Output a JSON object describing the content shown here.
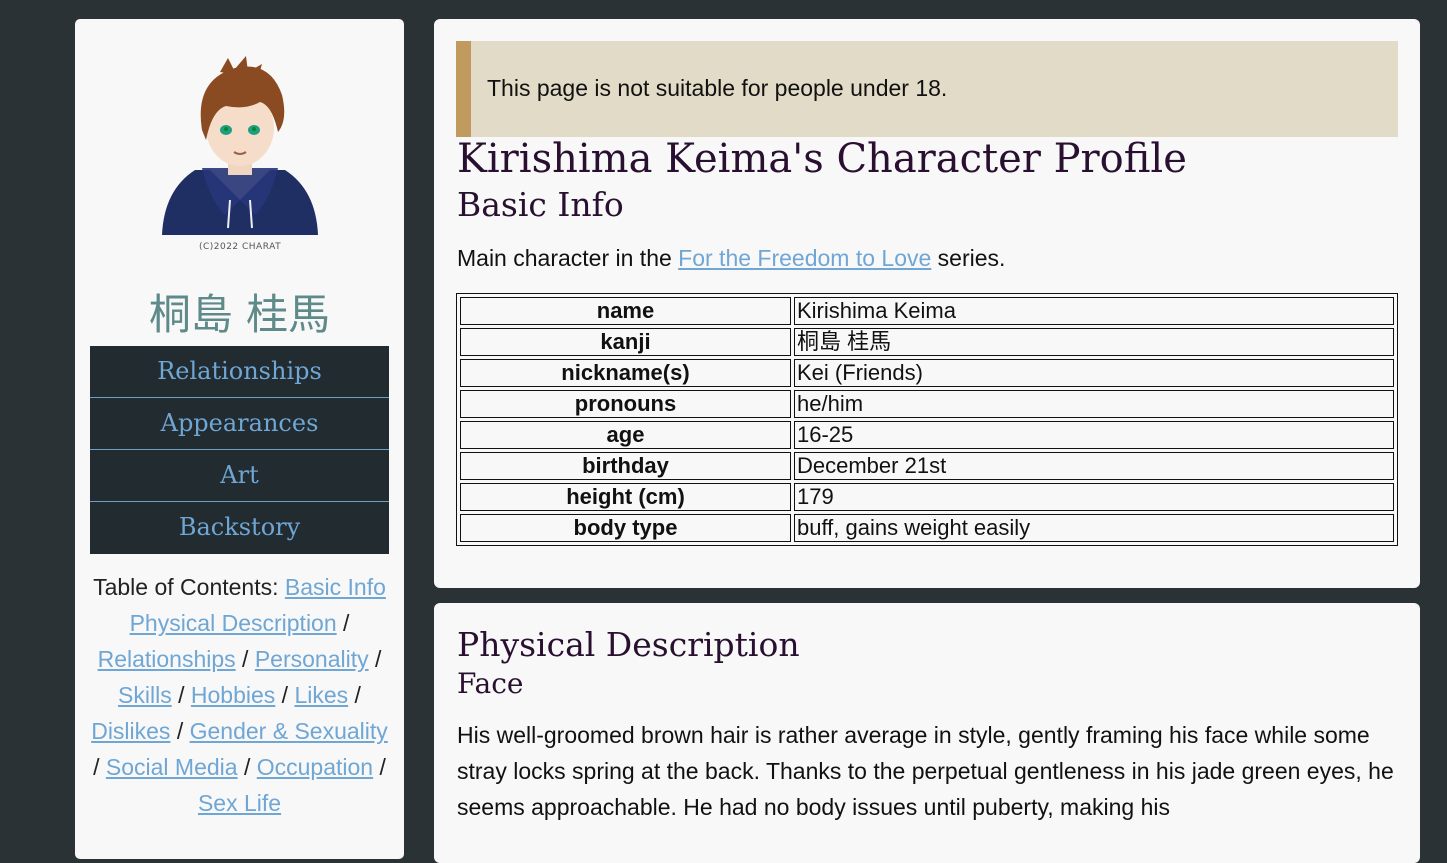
{
  "sidebar": {
    "avatar_caption": "(C)2022 CHARAT",
    "kanji_name": "桐島 桂馬",
    "nav": [
      "Relationships",
      "Appearances",
      "Art",
      "Backstory"
    ],
    "toc_label": "Table of Contents:",
    "toc_links": [
      "Basic Info",
      "Physical Description",
      "Relationships",
      "Personality",
      "Skills",
      "Hobbies",
      "Likes",
      "Dislikes",
      "Gender & Sexuality",
      "Social Media",
      "Occupation",
      "Sex Life"
    ]
  },
  "main": {
    "warning": "This page is not suitable for people under 18.",
    "title": "Kirishima Keima's Character Profile",
    "basic_info_heading": "Basic Info",
    "intro_before": "Main character in the ",
    "intro_link": "For the Freedom to Love",
    "intro_after": " series.",
    "info_rows": [
      {
        "key": "name",
        "value": "Kirishima Keima"
      },
      {
        "key": "kanji",
        "value": "桐島 桂馬"
      },
      {
        "key": "nickname(s)",
        "value": "Kei (Friends)"
      },
      {
        "key": "pronouns",
        "value": "he/him"
      },
      {
        "key": "age",
        "value": "16-25"
      },
      {
        "key": "birthday",
        "value": "December 21st"
      },
      {
        "key": "height (cm)",
        "value": "179"
      },
      {
        "key": "body type",
        "value": "buff, gains weight easily"
      }
    ]
  },
  "physical": {
    "heading": "Physical Description",
    "subheading": "Face",
    "paragraph": "His well-groomed brown hair is rather average in style, gently framing his face while some stray locks spring at the back. Thanks to the perpetual gentleness in his jade green eyes, he seems approachable. He had no body issues until puberty, making his"
  },
  "colors": {
    "background": "#2b3236",
    "nav_bg": "#212b30",
    "link": "#6fa6d4",
    "warning_bg": "#e2dbc7",
    "warning_border": "#c19a60",
    "heading": "#2a1030"
  }
}
